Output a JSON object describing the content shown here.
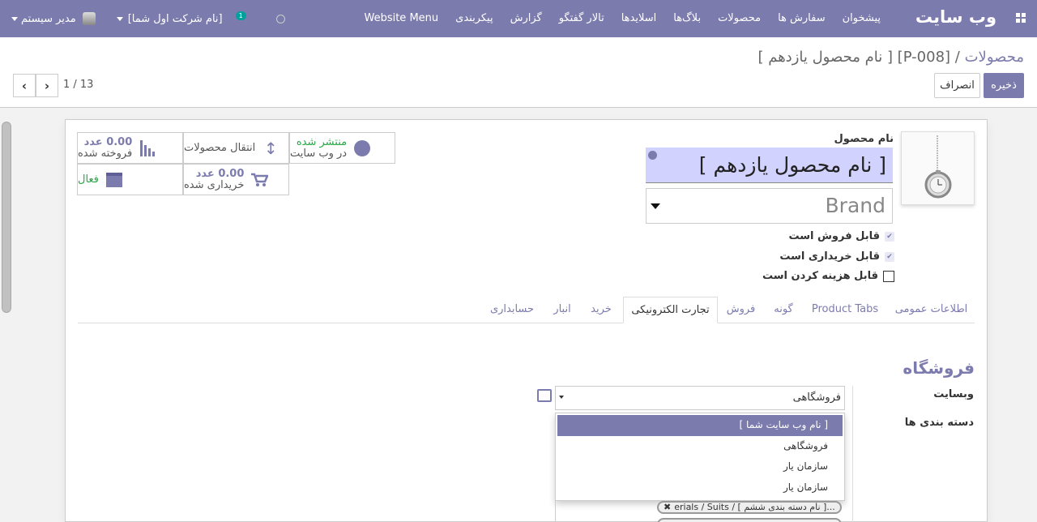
{
  "nav": {
    "app_name": "وب سایت",
    "menu": [
      "پیشخوان",
      "سفارش ها",
      "محصولات",
      "بلاگ‌ها",
      "اسلایدها",
      "تالار گفتگو",
      "گزارش",
      "پیکربندی",
      "Website Menu"
    ],
    "chat_badge": "1",
    "company": "[نام شرکت اول شما]",
    "user": "مدیر سیستم"
  },
  "breadcrumb": {
    "parent": "محصولات",
    "separator": "/",
    "current": "[P-008] [ نام محصول یازدهم ]"
  },
  "buttons": {
    "save": "ذخیره",
    "discard": "انصراف"
  },
  "pager": {
    "value": "1 / 13",
    "prev": "‹",
    "next": "›"
  },
  "stats": {
    "published": {
      "line1": "منتشر شده",
      "line2": "در وب سایت"
    },
    "moves": {
      "label": "انتقال محصولات"
    },
    "sold": {
      "value": "0.00 عدد",
      "label": "فروخته شده"
    },
    "active": {
      "label": "فعال"
    },
    "purchased": {
      "value": "0.00 عدد",
      "label": "خریداری شده"
    }
  },
  "product": {
    "name_label": "نام محصول",
    "name": "[ نام محصول یازدهم ]",
    "brand_placeholder": "Brand"
  },
  "checkboxes": [
    {
      "label": "قابل فروش است",
      "checked": true
    },
    {
      "label": "قابل خریداری است",
      "checked": true
    },
    {
      "label": "قابل هزینه کردن است",
      "checked": false
    }
  ],
  "tabs": [
    "اطلاعات عمومی",
    "Product Tabs",
    "گونه",
    "فروش",
    "تجارت الکترونیکی",
    "خرید",
    "انبار",
    "حسابداری"
  ],
  "active_tab": "تجارت الکترونیکی",
  "ecommerce": {
    "section_title": "فروشگاه",
    "website_label": "وبسایت",
    "category_label": "دسته بندی ها",
    "website_value": "فروشگاهی",
    "dropdown_options": [
      "[ نام وب سایت شما ]",
      "فروشگاهی",
      "سازمان یار",
      "سازمان یار"
    ],
    "tag1": "erials / Suits / [ نام دسته بندی ششم ]..."
  },
  "colors": {
    "brand": "#7c7bad",
    "green": "#28a745",
    "name_bg": "#d2d2ff"
  }
}
